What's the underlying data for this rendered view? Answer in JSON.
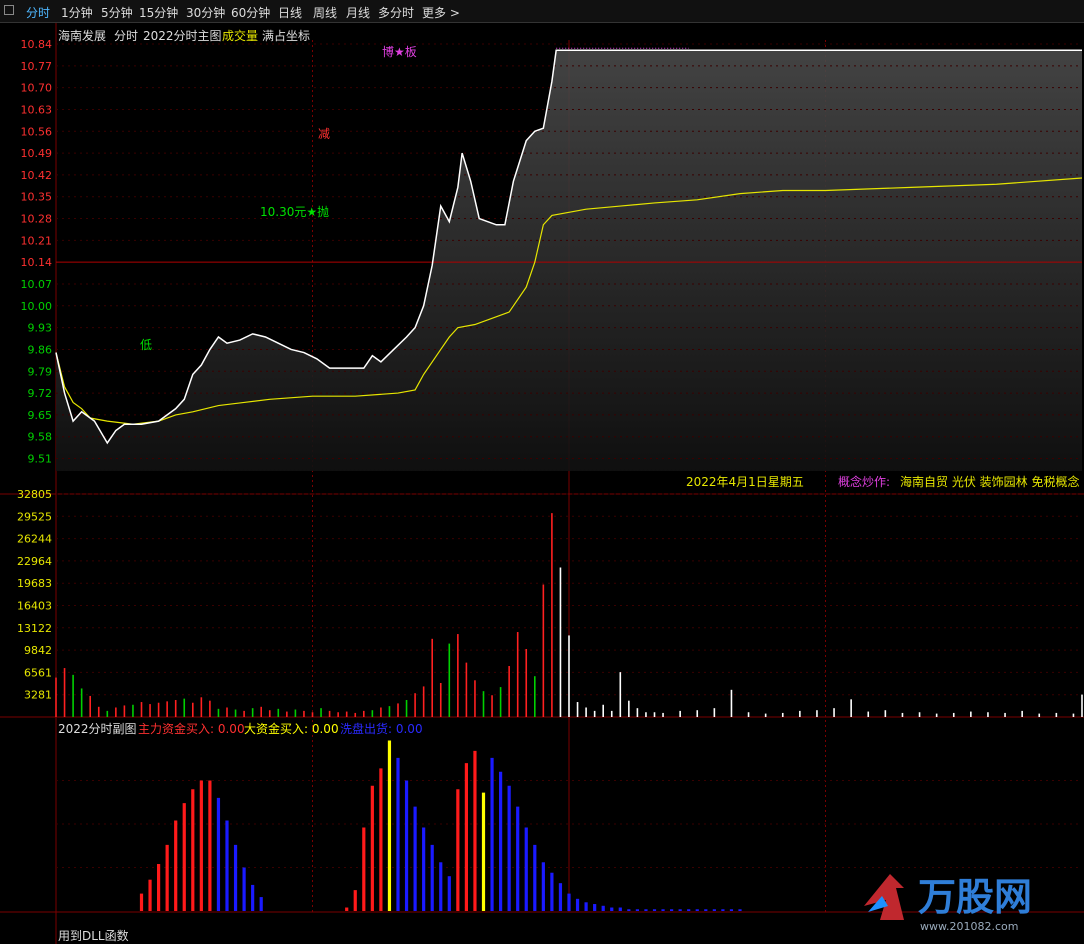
{
  "toolbar": {
    "items": [
      {
        "label": "分时",
        "active": true
      },
      {
        "label": "1分钟"
      },
      {
        "label": "5分钟"
      },
      {
        "label": "15分钟"
      },
      {
        "label": "30分钟"
      },
      {
        "label": "60分钟"
      },
      {
        "label": "日线"
      },
      {
        "label": "周线"
      },
      {
        "label": "月线"
      },
      {
        "label": "多分时"
      },
      {
        "label": "更多 >"
      }
    ]
  },
  "header": {
    "stock": "海南发展",
    "mode": "分时",
    "indicator": "2022分时主图",
    "volume_label": "成交量",
    "fullscale": "满占坐标"
  },
  "sub_indicator": {
    "name": "2022分时副图",
    "main_inflow": "主力资金买入: 0.00",
    "big_inflow": "大资金买入: 0.00",
    "dump": "洗盘出货: 0.00",
    "footer": "用到DLL函数"
  },
  "info": {
    "date": "2022年4月1日星期五",
    "concept_label": "概念炒作:",
    "concepts": "海南自贸 光伏 装饰园林 免税概念"
  },
  "annotations": {
    "limit": "博★板",
    "reduce": "减",
    "low": "低",
    "sell": "10.30元★抛"
  },
  "watermark": {
    "brand": "万股网",
    "url": "www.201082.com"
  },
  "colors": {
    "up": "#ff2020",
    "down": "#00d000",
    "price_line": "#ffffff",
    "avg_line": "#e6e600",
    "grid": "#7a0000",
    "main_flow": "#ff1a1a",
    "big_flow": "#ffff00",
    "dump_flow": "#1a1aff"
  },
  "chart_data": [
    {
      "type": "line",
      "name": "intraday-price",
      "y_ticks": [
        10.84,
        10.77,
        10.7,
        10.63,
        10.56,
        10.49,
        10.42,
        10.35,
        10.28,
        10.21,
        10.14,
        10.07,
        10.0,
        9.93,
        9.86,
        9.79,
        9.72,
        9.65,
        9.58,
        9.51
      ],
      "ylim": [
        9.47,
        10.84
      ],
      "prev_close": 10.14,
      "minutes": 240,
      "price": [
        [
          0,
          9.85
        ],
        [
          2,
          9.72
        ],
        [
          4,
          9.63
        ],
        [
          6,
          9.66
        ],
        [
          9,
          9.63
        ],
        [
          12,
          9.56
        ],
        [
          14,
          9.6
        ],
        [
          16,
          9.62
        ],
        [
          20,
          9.62
        ],
        [
          24,
          9.63
        ],
        [
          28,
          9.67
        ],
        [
          30,
          9.7
        ],
        [
          32,
          9.78
        ],
        [
          34,
          9.81
        ],
        [
          36,
          9.86
        ],
        [
          38,
          9.9
        ],
        [
          40,
          9.88
        ],
        [
          43,
          9.89
        ],
        [
          46,
          9.91
        ],
        [
          49,
          9.9
        ],
        [
          52,
          9.88
        ],
        [
          55,
          9.86
        ],
        [
          58,
          9.85
        ],
        [
          61,
          9.83
        ],
        [
          64,
          9.8
        ],
        [
          68,
          9.8
        ],
        [
          72,
          9.8
        ],
        [
          74,
          9.84
        ],
        [
          76,
          9.82
        ],
        [
          79,
          9.86
        ],
        [
          82,
          9.9
        ],
        [
          84,
          9.93
        ],
        [
          86,
          10.0
        ],
        [
          88,
          10.13
        ],
        [
          90,
          10.32
        ],
        [
          92,
          10.27
        ],
        [
          94,
          10.38
        ],
        [
          95,
          10.49
        ],
        [
          97,
          10.4
        ],
        [
          99,
          10.28
        ],
        [
          101,
          10.27
        ],
        [
          103,
          10.26
        ],
        [
          105,
          10.26
        ],
        [
          107,
          10.4
        ],
        [
          110,
          10.53
        ],
        [
          112,
          10.56
        ],
        [
          114,
          10.57
        ],
        [
          116,
          10.72
        ],
        [
          117,
          10.82
        ],
        [
          240,
          10.82
        ]
      ],
      "avg": [
        [
          0,
          9.85
        ],
        [
          2,
          9.74
        ],
        [
          4,
          9.69
        ],
        [
          6,
          9.67
        ],
        [
          8,
          9.64
        ],
        [
          12,
          9.63
        ],
        [
          18,
          9.62
        ],
        [
          24,
          9.63
        ],
        [
          28,
          9.65
        ],
        [
          32,
          9.66
        ],
        [
          38,
          9.68
        ],
        [
          44,
          9.69
        ],
        [
          50,
          9.7
        ],
        [
          60,
          9.71
        ],
        [
          70,
          9.71
        ],
        [
          80,
          9.72
        ],
        [
          84,
          9.73
        ],
        [
          86,
          9.78
        ],
        [
          88,
          9.82
        ],
        [
          90,
          9.86
        ],
        [
          92,
          9.9
        ],
        [
          94,
          9.93
        ],
        [
          98,
          9.94
        ],
        [
          102,
          9.96
        ],
        [
          106,
          9.98
        ],
        [
          110,
          10.06
        ],
        [
          112,
          10.14
        ],
        [
          114,
          10.26
        ],
        [
          116,
          10.29
        ],
        [
          124,
          10.31
        ],
        [
          132,
          10.32
        ],
        [
          140,
          10.33
        ],
        [
          150,
          10.34
        ],
        [
          160,
          10.36
        ],
        [
          170,
          10.37
        ],
        [
          180,
          10.37
        ],
        [
          200,
          10.38
        ],
        [
          220,
          10.39
        ],
        [
          240,
          10.41
        ]
      ]
    },
    {
      "type": "bar",
      "name": "volume",
      "y_ticks": [
        32805,
        29525,
        26244,
        22964,
        19683,
        16403,
        13122,
        9842,
        6561,
        3281
      ],
      "ylim": [
        0,
        32805
      ],
      "bars": [
        [
          0,
          5800,
          "up"
        ],
        [
          2,
          7200,
          "up"
        ],
        [
          4,
          6200,
          "down"
        ],
        [
          6,
          4200,
          "down"
        ],
        [
          8,
          3100,
          "up"
        ],
        [
          10,
          1500,
          "up"
        ],
        [
          12,
          900,
          "down"
        ],
        [
          14,
          1400,
          "up"
        ],
        [
          16,
          1700,
          "up"
        ],
        [
          18,
          1800,
          "down"
        ],
        [
          20,
          2200,
          "up"
        ],
        [
          22,
          1900,
          "up"
        ],
        [
          24,
          2100,
          "up"
        ],
        [
          26,
          2300,
          "up"
        ],
        [
          28,
          2500,
          "up"
        ],
        [
          30,
          2700,
          "down"
        ],
        [
          32,
          2100,
          "up"
        ],
        [
          34,
          2900,
          "up"
        ],
        [
          36,
          2400,
          "up"
        ],
        [
          38,
          1200,
          "down"
        ],
        [
          40,
          1400,
          "up"
        ],
        [
          42,
          1100,
          "down"
        ],
        [
          44,
          900,
          "up"
        ],
        [
          46,
          1300,
          "down"
        ],
        [
          48,
          1500,
          "up"
        ],
        [
          50,
          1000,
          "up"
        ],
        [
          52,
          1200,
          "down"
        ],
        [
          54,
          800,
          "up"
        ],
        [
          56,
          1100,
          "down"
        ],
        [
          58,
          900,
          "up"
        ],
        [
          60,
          700,
          "up"
        ],
        [
          62,
          1300,
          "down"
        ],
        [
          64,
          900,
          "up"
        ],
        [
          66,
          700,
          "up"
        ],
        [
          68,
          800,
          "up"
        ],
        [
          70,
          600,
          "up"
        ],
        [
          72,
          900,
          "up"
        ],
        [
          74,
          1000,
          "down"
        ],
        [
          76,
          1400,
          "up"
        ],
        [
          78,
          1600,
          "down"
        ],
        [
          80,
          2000,
          "up"
        ],
        [
          82,
          2500,
          "down"
        ],
        [
          84,
          3500,
          "up"
        ],
        [
          86,
          4500,
          "up"
        ],
        [
          88,
          11500,
          "up"
        ],
        [
          90,
          5000,
          "up"
        ],
        [
          92,
          10800,
          "down"
        ],
        [
          94,
          12200,
          "up"
        ],
        [
          96,
          8000,
          "up"
        ],
        [
          98,
          5400,
          "up"
        ],
        [
          100,
          3800,
          "down"
        ],
        [
          102,
          3200,
          "up"
        ],
        [
          104,
          4400,
          "down"
        ],
        [
          106,
          7500,
          "up"
        ],
        [
          108,
          12500,
          "up"
        ],
        [
          110,
          10000,
          "up"
        ],
        [
          112,
          6000,
          "down"
        ],
        [
          114,
          19500,
          "up"
        ],
        [
          116,
          30000,
          "up"
        ],
        [
          118,
          22000,
          "white"
        ],
        [
          120,
          12000,
          "white"
        ],
        [
          122,
          2200,
          "white"
        ],
        [
          124,
          1400,
          "white"
        ],
        [
          126,
          900,
          "white"
        ],
        [
          128,
          1800,
          "white"
        ],
        [
          130,
          900,
          "white"
        ],
        [
          132,
          6600,
          "white"
        ],
        [
          134,
          2400,
          "white"
        ],
        [
          136,
          1300,
          "white"
        ],
        [
          138,
          700,
          "white"
        ],
        [
          140,
          700,
          "white"
        ],
        [
          142,
          600,
          "white"
        ],
        [
          146,
          900,
          "white"
        ],
        [
          150,
          1000,
          "white"
        ],
        [
          154,
          1300,
          "white"
        ],
        [
          158,
          4000,
          "white"
        ],
        [
          162,
          700,
          "white"
        ],
        [
          166,
          500,
          "white"
        ],
        [
          170,
          600,
          "white"
        ],
        [
          174,
          900,
          "white"
        ],
        [
          178,
          1000,
          "white"
        ],
        [
          182,
          1300,
          "white"
        ],
        [
          186,
          2600,
          "white"
        ],
        [
          190,
          800,
          "white"
        ],
        [
          194,
          1000,
          "white"
        ],
        [
          198,
          600,
          "white"
        ],
        [
          202,
          700,
          "white"
        ],
        [
          206,
          500,
          "white"
        ],
        [
          210,
          600,
          "white"
        ],
        [
          214,
          800,
          "white"
        ],
        [
          218,
          700,
          "white"
        ],
        [
          222,
          600,
          "white"
        ],
        [
          226,
          900,
          "white"
        ],
        [
          230,
          500,
          "white"
        ],
        [
          234,
          600,
          "white"
        ],
        [
          238,
          500,
          "white"
        ],
        [
          240,
          3300,
          "white"
        ]
      ]
    },
    {
      "type": "bar",
      "name": "fund-flow",
      "ylim": [
        0,
        100
      ],
      "series": [
        {
          "name": "主力资金买入",
          "bars": [
            [
              20,
              10
            ],
            [
              22,
              18
            ],
            [
              24,
              27
            ],
            [
              26,
              38
            ],
            [
              28,
              52
            ],
            [
              30,
              62
            ],
            [
              32,
              70
            ],
            [
              34,
              75
            ],
            [
              36,
              75
            ]
          ]
        },
        {
          "name": "洗盘出货",
          "bars": [
            [
              38,
              65
            ],
            [
              40,
              52
            ],
            [
              42,
              38
            ],
            [
              44,
              25
            ],
            [
              46,
              15
            ],
            [
              48,
              8
            ]
          ]
        },
        {
          "name": "主力资金买入",
          "bars": [
            [
              68,
              2
            ],
            [
              70,
              12
            ],
            [
              72,
              48
            ],
            [
              74,
              72
            ],
            [
              76,
              82
            ]
          ]
        },
        {
          "name": "大资金买入",
          "bars": [
            [
              78,
              98
            ]
          ]
        },
        {
          "name": "洗盘出货",
          "bars": [
            [
              80,
              88
            ],
            [
              82,
              75
            ],
            [
              84,
              60
            ],
            [
              86,
              48
            ],
            [
              88,
              38
            ],
            [
              90,
              28
            ],
            [
              92,
              20
            ]
          ]
        },
        {
          "name": "主力资金买入",
          "bars": [
            [
              94,
              70
            ],
            [
              96,
              85
            ],
            [
              98,
              92
            ]
          ]
        },
        {
          "name": "大资金买入",
          "bars": [
            [
              100,
              68
            ]
          ]
        },
        {
          "name": "洗盘出货",
          "bars": [
            [
              102,
              88
            ],
            [
              104,
              80
            ],
            [
              106,
              72
            ],
            [
              108,
              60
            ],
            [
              110,
              48
            ],
            [
              112,
              38
            ],
            [
              114,
              28
            ],
            [
              116,
              22
            ],
            [
              118,
              16
            ],
            [
              120,
              10
            ],
            [
              122,
              7
            ],
            [
              124,
              5
            ],
            [
              126,
              4
            ],
            [
              128,
              3
            ],
            [
              130,
              2
            ],
            [
              132,
              2
            ],
            [
              134,
              1
            ],
            [
              136,
              1
            ],
            [
              138,
              1
            ],
            [
              140,
              1
            ],
            [
              142,
              1
            ],
            [
              144,
              1
            ],
            [
              146,
              1
            ],
            [
              148,
              1
            ],
            [
              150,
              1
            ],
            [
              152,
              1
            ],
            [
              154,
              1
            ],
            [
              156,
              1
            ],
            [
              158,
              1
            ],
            [
              160,
              1
            ]
          ]
        }
      ]
    }
  ]
}
